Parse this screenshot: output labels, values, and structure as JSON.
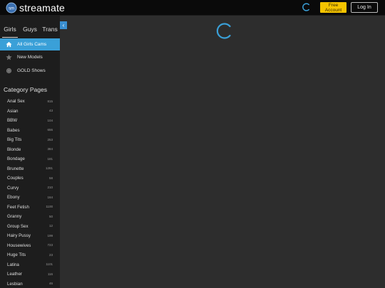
{
  "header": {
    "brand": "streamate",
    "free_account": "Free Account",
    "login": "Log In"
  },
  "tabs": [
    {
      "label": "Girls",
      "active": true
    },
    {
      "label": "Guys",
      "active": false
    },
    {
      "label": "Trans",
      "active": false
    }
  ],
  "nav": [
    {
      "label": "All Girls Cams",
      "icon": "home-icon",
      "active": true
    },
    {
      "label": "New Models",
      "icon": "star-icon",
      "active": false
    },
    {
      "label": "GOLD Shows",
      "icon": "coin-icon",
      "active": false
    }
  ],
  "categories": {
    "title": "Category Pages",
    "items": [
      {
        "name": "Anal Sex",
        "count": "815"
      },
      {
        "name": "Asian",
        "count": "43"
      },
      {
        "name": "BBW",
        "count": "104"
      },
      {
        "name": "Babes",
        "count": "656"
      },
      {
        "name": "Big Tits",
        "count": "253"
      },
      {
        "name": "Blonde",
        "count": "384"
      },
      {
        "name": "Bondage",
        "count": "181"
      },
      {
        "name": "Brunette",
        "count": "1281"
      },
      {
        "name": "Couples",
        "count": "58"
      },
      {
        "name": "Curvy",
        "count": "210"
      },
      {
        "name": "Ebony",
        "count": "164"
      },
      {
        "name": "Feet Fetish",
        "count": "1100"
      },
      {
        "name": "Granny",
        "count": "50"
      },
      {
        "name": "Group Sex",
        "count": "12"
      },
      {
        "name": "Hairy Pussy",
        "count": "199"
      },
      {
        "name": "Housewives",
        "count": "723"
      },
      {
        "name": "Huge Tits",
        "count": "23"
      },
      {
        "name": "Latina",
        "count": "1101"
      },
      {
        "name": "Leather",
        "count": "116"
      },
      {
        "name": "Lesbian",
        "count": "46"
      }
    ]
  },
  "colors": {
    "accent": "#3aa0d8",
    "gold": "#f5c400",
    "background": "#2d2d2d"
  }
}
